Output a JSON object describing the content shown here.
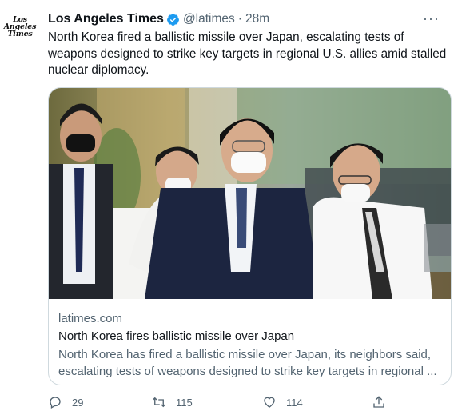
{
  "account": {
    "avatar_lines": [
      "Los",
      "Angeles",
      "Times"
    ],
    "name": "Los Angeles Times",
    "handle": "@latimes",
    "separator": "·",
    "time": "28m",
    "more": "···"
  },
  "tweet": {
    "text": "North Korea fired a ballistic missile over Japan, escalating tests of weapons designed to strike key targets in regional U.S. allies amid stalled nuclear diplomacy."
  },
  "card": {
    "domain": "latimes.com",
    "title": "North Korea fires ballistic missile over Japan",
    "description": "North Korea has fired a ballistic missile over Japan, its neighbors said, escalating tests of weapons designed to strike key targets in regional ..."
  },
  "actions": {
    "replies": "29",
    "retweets": "115",
    "likes": "114"
  },
  "colors": {
    "verified": "#1d9bf0",
    "secondary_text": "#536471",
    "border": "#cfd9de"
  },
  "icons": [
    "verified-badge-icon",
    "more-icon",
    "reply-icon",
    "retweet-icon",
    "like-icon",
    "share-icon"
  ]
}
